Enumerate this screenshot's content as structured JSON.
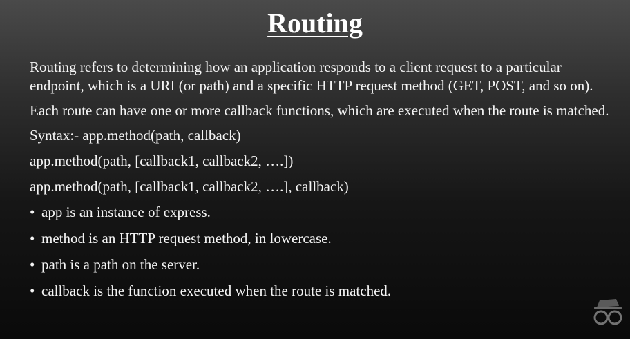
{
  "slide": {
    "title": "Routing",
    "paragraphs": [
      "Routing refers to determining how an application responds to a client request to a particular endpoint, which is a URI (or path) and a specific HTTP request method (GET, POST, and so on).",
      "Each route can have one or more callback functions, which are executed when the route is matched."
    ],
    "syntax": [
      "Syntax:- app.method(path, callback)",
      "app.method(path, [callback1, callback2, ….])",
      "app.method(path, [callback1, callback2, ….], callback)"
    ],
    "bullet_glyph": "•",
    "bullets": [
      "app is an instance of express.",
      "method is an HTTP request method, in lowercase.",
      "path is a path on the server.",
      "callback is the function executed when the route is matched."
    ]
  },
  "logo": {
    "icon": "glasses-hat-logo-icon"
  }
}
